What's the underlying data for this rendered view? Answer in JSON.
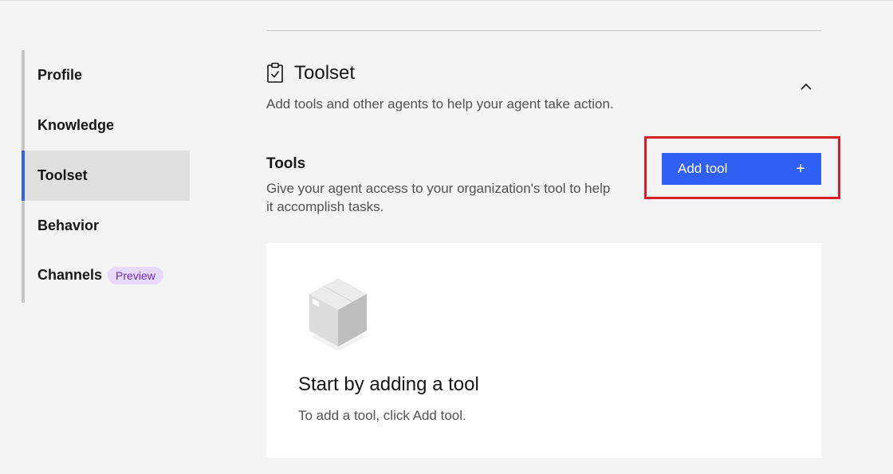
{
  "sidebar": {
    "items": [
      {
        "label": "Profile"
      },
      {
        "label": "Knowledge"
      },
      {
        "label": "Toolset"
      },
      {
        "label": "Behavior"
      },
      {
        "label": "Channels",
        "badge": "Preview"
      }
    ],
    "active": "Toolset"
  },
  "section": {
    "title": "Toolset",
    "icon": "clipboard-check-icon",
    "description": "Add tools and other agents to help your agent take action."
  },
  "tools": {
    "heading": "Tools",
    "description": "Give your agent access to your organization's tool to help it accomplish tasks.",
    "add_button_label": "Add tool",
    "add_button_icon": "+"
  },
  "empty_state": {
    "title": "Start by adding a tool",
    "description": "To add a tool, click Add tool."
  },
  "colors": {
    "accent": "#2f5ff3",
    "highlight": "#da1e28",
    "badge_bg": "#e8daff",
    "badge_text": "#6929c4"
  }
}
